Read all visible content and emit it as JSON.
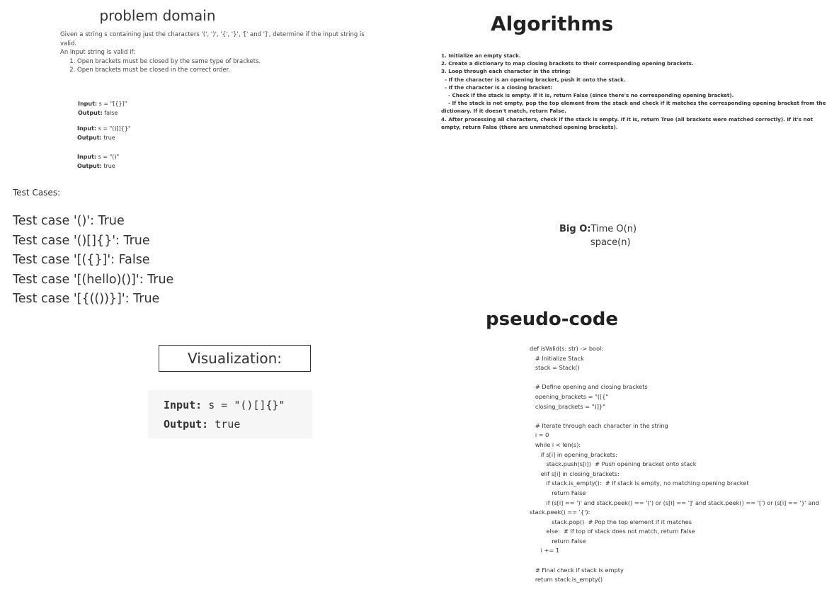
{
  "problem_domain": {
    "title": "problem domain",
    "description": "Given a string s containing just the characters '(', ')', '{', '}', '[' and ']', determine if the input string is valid.",
    "valid_if": "An input string is valid if:",
    "rules": [
      "Open brackets must be closed by the same type of brackets.",
      "Open brackets must be closed in the correct order."
    ],
    "examples": [
      {
        "input_label": "Input:",
        "input_value": "s = \"[{}]\"",
        "output_label": "Output:",
        "output_value": "false"
      },
      {
        "input_label": "Input:",
        "input_value": "s = \"()[]{}\"",
        "output_label": "Output:",
        "output_value": "true"
      },
      {
        "input_label": "Input:",
        "input_value": "s = \"()\"",
        "output_label": "Output:",
        "output_value": "true"
      }
    ]
  },
  "test_cases": {
    "heading": "Test Cases:",
    "items": [
      "Test case '()': True",
      "Test case '()[]{}': True",
      "Test case '[({}]': False",
      "Test case '[(hello)()]': True",
      "Test case '[{(())}]': True"
    ]
  },
  "visualization": {
    "title": "Visualization:",
    "input_label": "Input:",
    "input_value": " s = \"()[]{}\"",
    "output_label": "Output:",
    "output_value": " true"
  },
  "algorithms": {
    "title": "Algorithms",
    "steps": [
      "1. Initialize an empty stack.",
      "2. Create a dictionary to map closing brackets to their corresponding opening brackets.",
      "3. Loop through each character in the string:",
      "  - If the character is an opening bracket, push it onto the stack.",
      "  - If the character is a closing bracket:",
      "    - Check if the stack is empty. If it is, return False (since there's no corresponding opening bracket).",
      "    - If the stack is not empty, pop the top element from the stack and check if it matches the corresponding opening bracket from the dictionary. If it doesn't match, return False.",
      "4. After processing all characters, check if the stack is empty. If it is, return True (all brackets were matched correctly). If it's not empty, return False (there are unmatched opening brackets)."
    ]
  },
  "big_o": {
    "label": "Big O:",
    "time": "Time O(n)",
    "space": "space(n)"
  },
  "pseudo_code": {
    "title": "pseudo-code",
    "lines": [
      "def isValid(s: str) -> bool:",
      "   # Initialize Stack",
      "   stack = Stack()",
      "",
      "   # Define opening and closing brackets",
      "   opening_brackets = \"([{\"",
      "   closing_brackets = \")]}\"",
      "",
      "   # Iterate through each character in the string",
      "   i = 0",
      "   while i < len(s):",
      "      if s[i] in opening_brackets:",
      "         stack.push(s[i])  # Push opening bracket onto stack",
      "      elif s[i] in closing_brackets:",
      "         if stack.is_empty():  # If stack is empty, no matching opening bracket",
      "            return False",
      "         if (s[i] == ')' and stack.peek() == '(') or (s[i] == ']' and stack.peek() == '[') or (s[i] == '}' and stack.peek() == '{'):",
      "            stack.pop()  # Pop the top element if it matches",
      "         else:  # If top of stack does not match, return False",
      "            return False",
      "      i += 1",
      "",
      "   # Final check if stack is empty",
      "   return stack.is_empty()"
    ]
  }
}
